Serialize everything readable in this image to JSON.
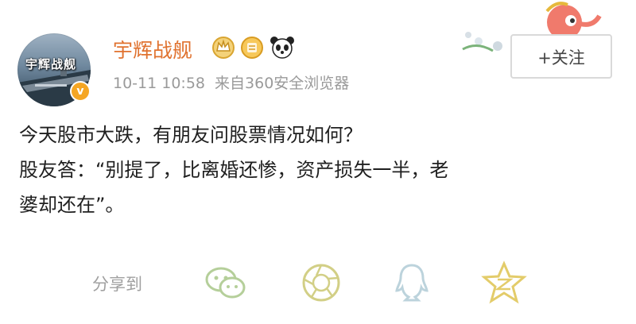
{
  "post": {
    "author": "宇辉战舰",
    "avatar_text": "宇辉战舰",
    "verified_mark": "v",
    "time": "10-11 10:58",
    "source": "来自360安全浏览器",
    "follow_label": "+关注",
    "lines": [
      "今天股市大跌，有朋友问股票情况如何？",
      "股友答：“别提了，比离婚还惨，资产损失一半，老",
      "婆却还在”。"
    ]
  },
  "share": {
    "label": "分享到",
    "targets": [
      "wechat-icon",
      "moments-icon",
      "qq-icon",
      "qzone-icon"
    ]
  },
  "colors": {
    "username": "#e0722f",
    "meta": "#9a9a9a",
    "icon_stroke": "#c9c98a",
    "badge_gold": "#e8b84a"
  }
}
